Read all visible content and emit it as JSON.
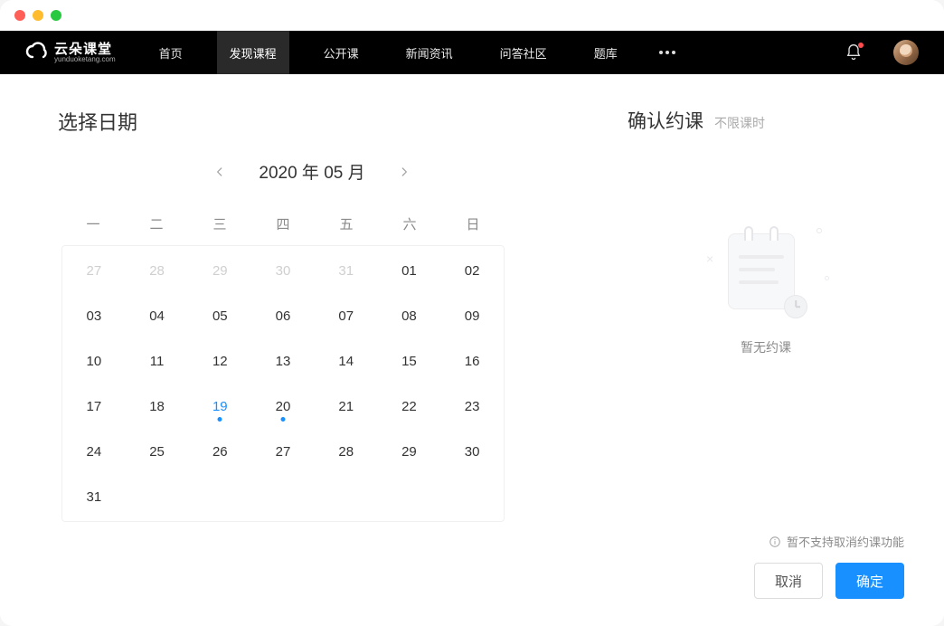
{
  "window": {
    "traffic": [
      "close",
      "minimize",
      "zoom"
    ]
  },
  "brand": {
    "name": "云朵课堂",
    "domain": "yunduoketang.com"
  },
  "nav": {
    "items": [
      {
        "label": "首页",
        "active": false
      },
      {
        "label": "发现课程",
        "active": true
      },
      {
        "label": "公开课",
        "active": false
      },
      {
        "label": "新闻资讯",
        "active": false
      },
      {
        "label": "问答社区",
        "active": false
      },
      {
        "label": "题库",
        "active": false
      }
    ],
    "has_more": true,
    "notifications": {
      "has_unread": true
    }
  },
  "calendar": {
    "title": "选择日期",
    "month_label": "2020 年 05 月",
    "year": 2020,
    "month": 5,
    "weekdays": [
      "一",
      "二",
      "三",
      "四",
      "五",
      "六",
      "日"
    ],
    "days": [
      {
        "d": "27",
        "other": true
      },
      {
        "d": "28",
        "other": true
      },
      {
        "d": "29",
        "other": true
      },
      {
        "d": "30",
        "other": true
      },
      {
        "d": "31",
        "other": true
      },
      {
        "d": "01"
      },
      {
        "d": "02"
      },
      {
        "d": "03"
      },
      {
        "d": "04"
      },
      {
        "d": "05"
      },
      {
        "d": "06"
      },
      {
        "d": "07"
      },
      {
        "d": "08"
      },
      {
        "d": "09"
      },
      {
        "d": "10"
      },
      {
        "d": "11"
      },
      {
        "d": "12"
      },
      {
        "d": "13"
      },
      {
        "d": "14"
      },
      {
        "d": "15"
      },
      {
        "d": "16"
      },
      {
        "d": "17"
      },
      {
        "d": "18"
      },
      {
        "d": "19",
        "today": true,
        "dot": true
      },
      {
        "d": "20",
        "dot": true
      },
      {
        "d": "21"
      },
      {
        "d": "22"
      },
      {
        "d": "23"
      },
      {
        "d": "24"
      },
      {
        "d": "25"
      },
      {
        "d": "26"
      },
      {
        "d": "27"
      },
      {
        "d": "28"
      },
      {
        "d": "29"
      },
      {
        "d": "30"
      },
      {
        "d": "31"
      }
    ]
  },
  "confirm": {
    "title": "确认约课",
    "subtitle": "不限课时",
    "empty_text": "暂无约课",
    "note": "暂不支持取消约课功能",
    "cancel_label": "取消",
    "ok_label": "确定"
  },
  "colors": {
    "primary": "#1890ff"
  }
}
